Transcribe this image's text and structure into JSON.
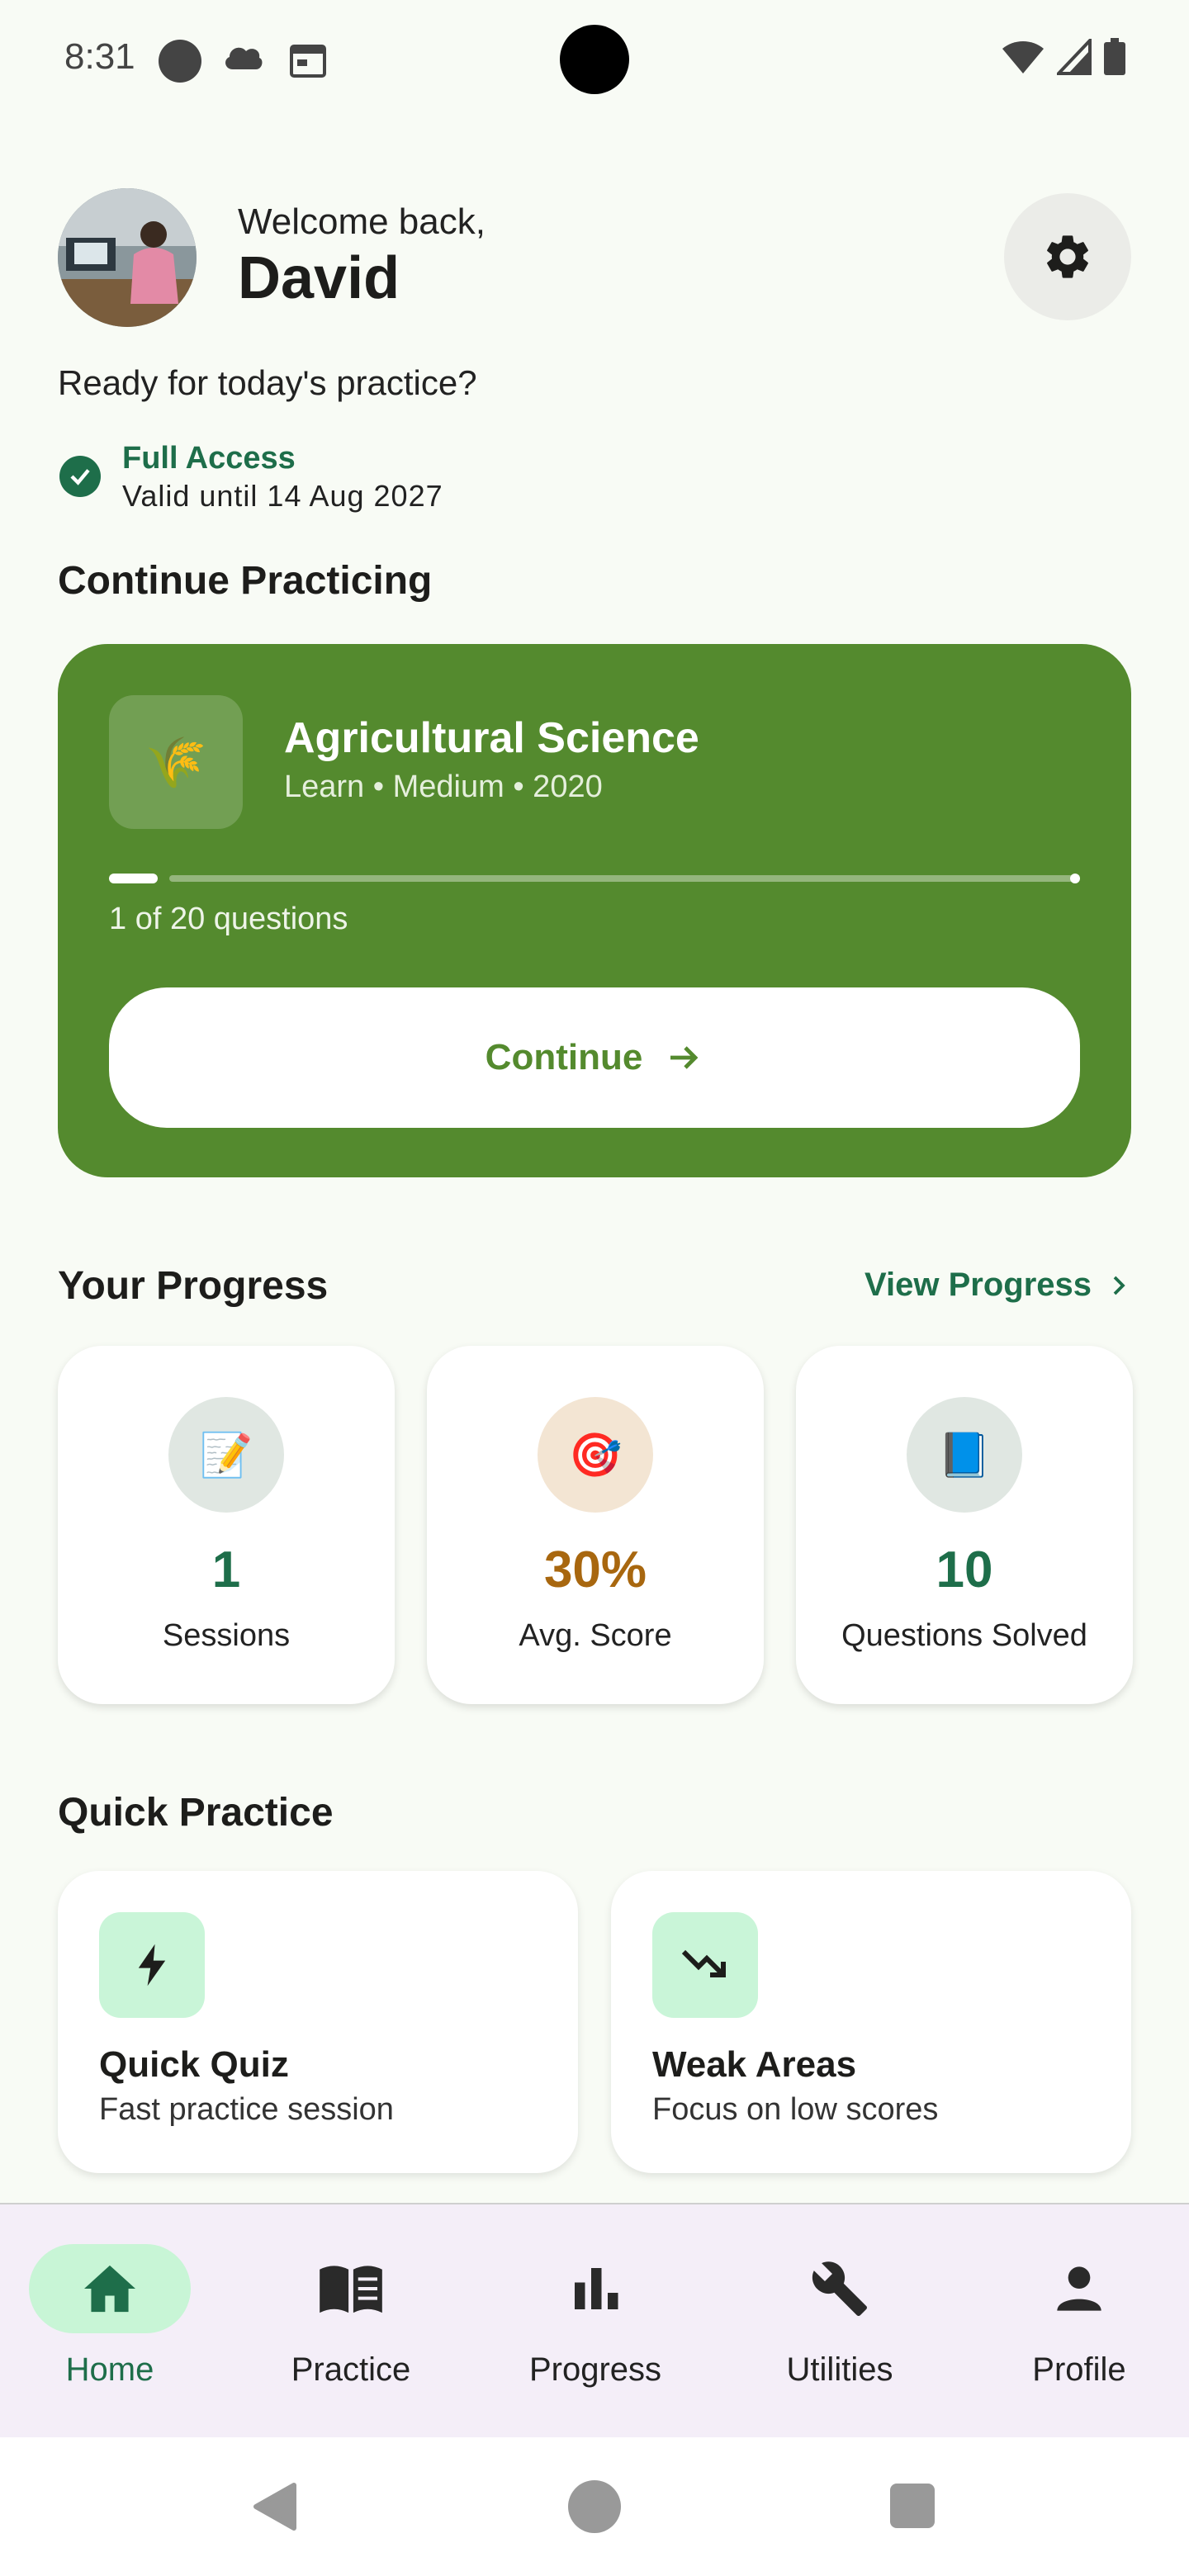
{
  "status_bar": {
    "time": "8:31"
  },
  "header": {
    "welcome": "Welcome back,",
    "name": "David",
    "tagline": "Ready for today's practice?",
    "access_title": "Full Access",
    "access_valid": "Valid until 14 Aug 2027"
  },
  "continue_section": {
    "title": "Continue Practicing",
    "subject": "Agricultural Science",
    "meta": "Learn • Medium • 2020",
    "progress_label": "1 of 20 questions",
    "progress": {
      "current": 1,
      "total": 20
    },
    "button_label": "Continue",
    "card_color": "#548a2e"
  },
  "progress_section": {
    "title": "Your Progress",
    "view_link": "View Progress",
    "stats": [
      {
        "value": "1",
        "label": "Sessions",
        "icon": "memo-icon",
        "value_color": "#1e6e4a",
        "circle_color": "#e0e7e2"
      },
      {
        "value": "30%",
        "label": "Avg. Score",
        "icon": "target-icon",
        "value_color": "#a8670f",
        "circle_color": "#f3e5d3"
      },
      {
        "value": "10",
        "label": "Questions Solved",
        "icon": "book-icon",
        "value_color": "#1e6e4a",
        "circle_color": "#e0e7e2"
      }
    ]
  },
  "quick_section": {
    "title": "Quick Practice",
    "cards": [
      {
        "title": "Quick Quiz",
        "subtitle": "Fast practice session",
        "icon": "bolt-icon"
      },
      {
        "title": "Weak Areas",
        "subtitle": "Focus on low scores",
        "icon": "trending-down-icon"
      }
    ]
  },
  "bottom_nav": {
    "items": [
      {
        "label": "Home",
        "icon": "home-icon",
        "active": true
      },
      {
        "label": "Practice",
        "icon": "book-open-icon",
        "active": false
      },
      {
        "label": "Progress",
        "icon": "bar-chart-icon",
        "active": false
      },
      {
        "label": "Utilities",
        "icon": "wrench-icon",
        "active": false
      },
      {
        "label": "Profile",
        "icon": "person-icon",
        "active": false
      }
    ]
  },
  "colors": {
    "accent": "#1e6e4a",
    "background": "#f8fbf5",
    "nav_active": "#c8f5d6"
  }
}
